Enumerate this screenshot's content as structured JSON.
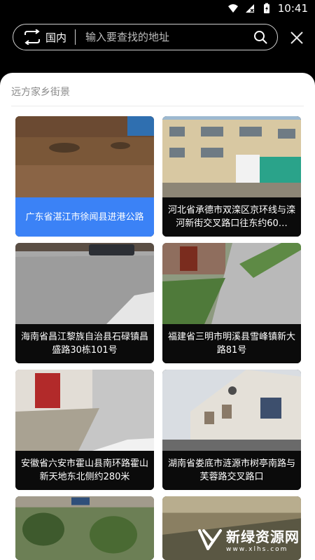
{
  "status": {
    "time": "10:41"
  },
  "search": {
    "region": "国内",
    "placeholder": "输入要查找的地址"
  },
  "section": {
    "title": "远方家乡街景"
  },
  "places": [
    {
      "caption": "广东省湛江市徐闻县进港公路",
      "selected": true
    },
    {
      "caption": "河北省承德市双滦区京环线与滦河新街交叉路口往东约60…",
      "selected": false
    },
    {
      "caption": "海南省昌江黎族自治县石碌镇昌盛路30栋101号",
      "selected": false
    },
    {
      "caption": "福建省三明市明溪县雪峰镇新大路81号",
      "selected": false
    },
    {
      "caption": "安徽省六安市霍山县南环路霍山新天地东北侧约280米",
      "selected": false
    },
    {
      "caption": "湖南省娄底市涟源市树亭南路与芙蓉路交叉路口",
      "selected": false
    }
  ],
  "watermark": {
    "name": "新绿资源网",
    "url": "www.xlhs.com"
  },
  "colors": {
    "accent": "#3b82f6",
    "background": "#000000",
    "panel": "#ffffff"
  }
}
